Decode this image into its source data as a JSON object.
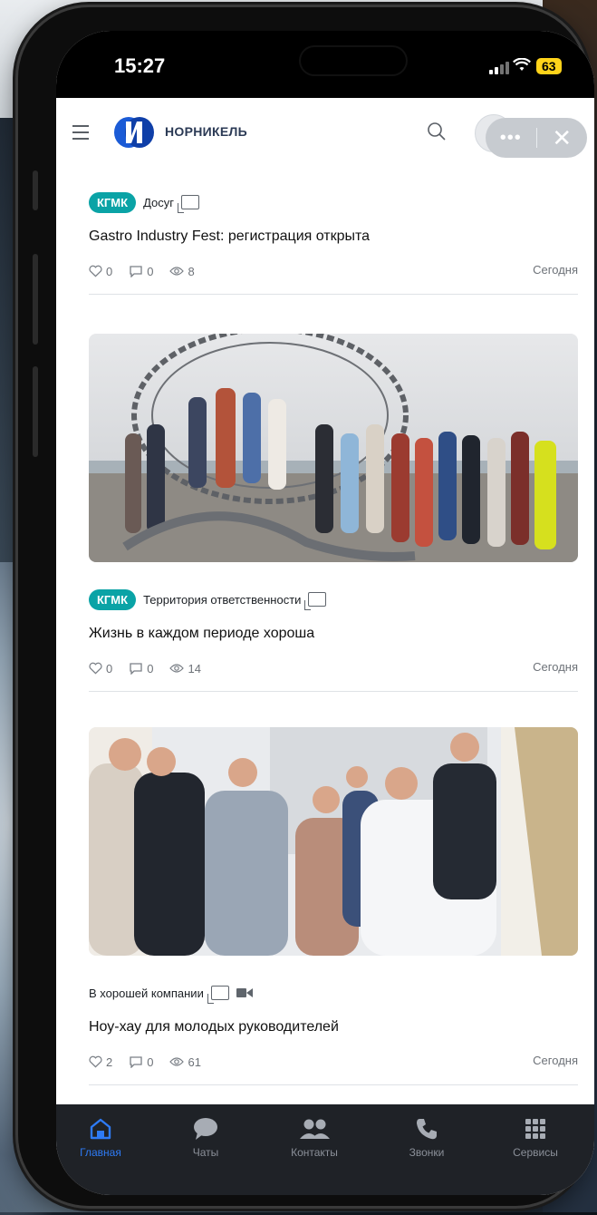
{
  "status_bar": {
    "time": "15:27",
    "battery": "63"
  },
  "header": {
    "brand": "НОРНИКЕЛЬ"
  },
  "posts": [
    {
      "badge": "КГМК",
      "category": "Досуг",
      "title": "Gastro Industry Fest: регистрация открыта",
      "likes": "0",
      "comments": "0",
      "views": "8",
      "date": "Сегодня"
    },
    {
      "badge": "КГМК",
      "category": "Территория ответственности",
      "title": "Жизнь в каждом периоде хороша",
      "likes": "0",
      "comments": "0",
      "views": "14",
      "date": "Сегодня"
    },
    {
      "category": "В хорошей компании",
      "title": "Ноу-хау для молодых руководителей",
      "likes": "2",
      "comments": "0",
      "views": "61",
      "date": "Сегодня"
    }
  ],
  "tabbar": {
    "items": [
      {
        "label": "Главная",
        "icon": "home-icon",
        "active": true
      },
      {
        "label": "Чаты",
        "icon": "chat-icon"
      },
      {
        "label": "Контакты",
        "icon": "contacts-icon"
      },
      {
        "label": "Звонки",
        "icon": "phone-icon"
      },
      {
        "label": "Сервисы",
        "icon": "grid-icon"
      }
    ]
  },
  "colors": {
    "accent_teal": "#0aa3a6",
    "active_tab": "#2e7bf6",
    "brand_blue": "#1b5bd6"
  }
}
